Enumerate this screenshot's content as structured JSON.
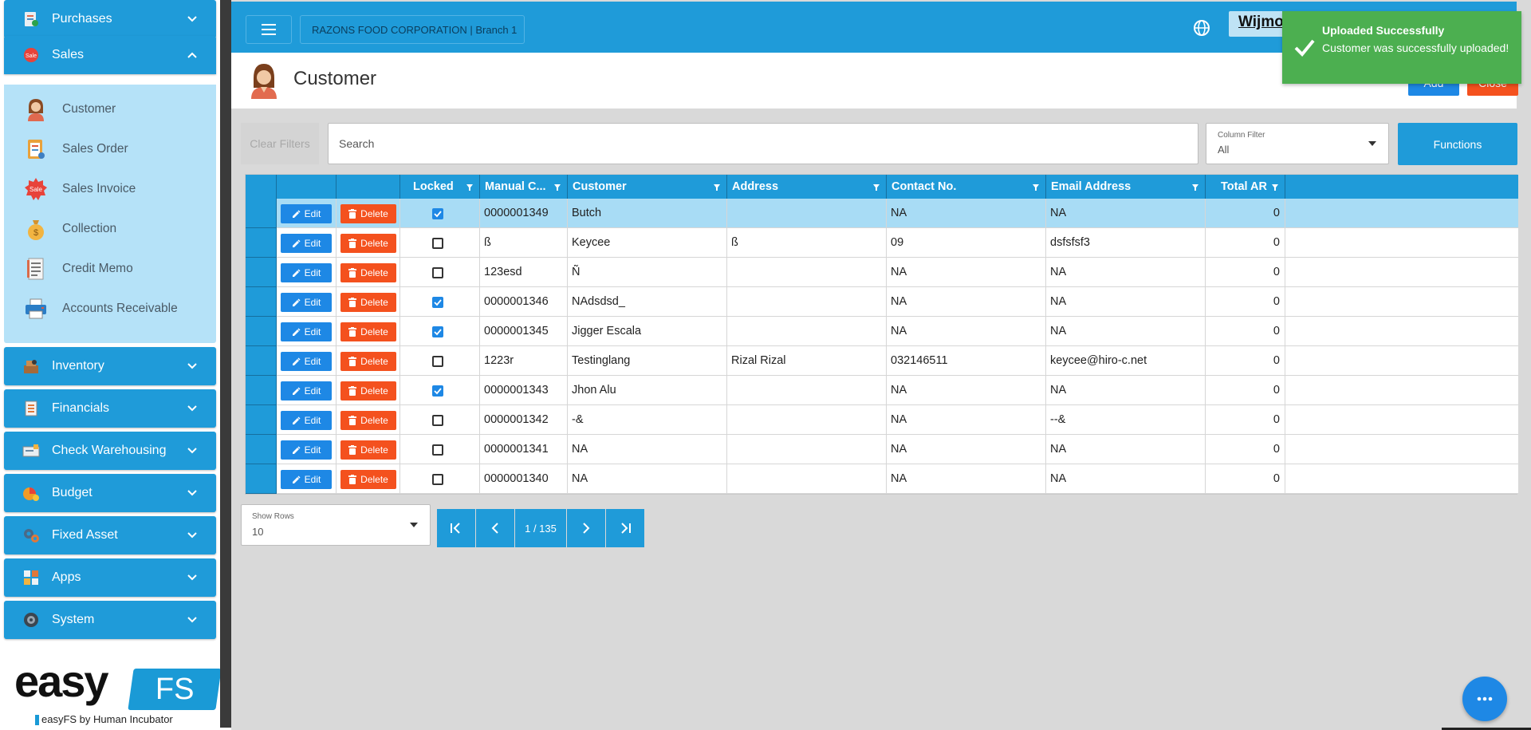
{
  "sidebar": {
    "groups_top": [
      {
        "label": "Purchases",
        "icon": "purchases-icon"
      },
      {
        "label": "Sales",
        "icon": "sale-tag-icon"
      }
    ],
    "sales_items": [
      {
        "label": "Customer",
        "icon": "customer-avatar-icon"
      },
      {
        "label": "Sales Order",
        "icon": "sales-order-icon"
      },
      {
        "label": "Sales Invoice",
        "icon": "sale-badge-icon"
      },
      {
        "label": "Collection",
        "icon": "money-bag-icon"
      },
      {
        "label": "Credit Memo",
        "icon": "memo-icon"
      },
      {
        "label": "Accounts Receivable",
        "icon": "printer-icon"
      }
    ],
    "groups_bottom": [
      {
        "label": "Inventory",
        "icon": "inventory-icon"
      },
      {
        "label": "Financials",
        "icon": "financials-icon"
      },
      {
        "label": "Check Warehousing",
        "icon": "check-icon"
      },
      {
        "label": "Budget",
        "icon": "budget-icon"
      },
      {
        "label": "Fixed Asset",
        "icon": "fixed-asset-icon"
      },
      {
        "label": "Apps",
        "icon": "apps-icon"
      },
      {
        "label": "System",
        "icon": "system-gear-icon"
      }
    ],
    "brand": {
      "easy": "easy",
      "fs": "FS",
      "tagline": "easyFS by Human Incubator"
    }
  },
  "topbar": {
    "company": "RAZONS FOOD CORPORATION | Branch 1",
    "user": "Wijmo"
  },
  "page": {
    "title": "Customer",
    "add_label": "Add",
    "close_label": "Close"
  },
  "toast": {
    "title": "Uploaded Successfully",
    "message": "Customer was successfully uploaded!"
  },
  "filters": {
    "clear_label": "Clear Filters",
    "search_placeholder": "Search",
    "column_filter_label": "Column Filter",
    "column_filter_value": "All",
    "functions_label": "Functions"
  },
  "grid": {
    "edit_label": "Edit",
    "delete_label": "Delete",
    "columns": [
      "Locked",
      "Manual C...",
      "Customer",
      "Address",
      "Contact No.",
      "Email Address",
      "Total AR"
    ],
    "rows": [
      {
        "locked": true,
        "manual_code": "0000001349",
        "customer": "Butch",
        "address": "",
        "contact": "NA",
        "email": "NA",
        "total_ar": "0",
        "selected": true
      },
      {
        "locked": false,
        "manual_code": "ß",
        "customer": "Keycee",
        "address": "ß",
        "contact": "09",
        "email": "dsfsfsf3",
        "total_ar": "0"
      },
      {
        "locked": false,
        "manual_code": "123esd",
        "customer": "Ñ",
        "address": "",
        "contact": "NA",
        "email": "NA",
        "total_ar": "0"
      },
      {
        "locked": true,
        "manual_code": "0000001346",
        "customer": "NAdsdsd_",
        "address": "",
        "contact": "NA",
        "email": "NA",
        "total_ar": "0"
      },
      {
        "locked": true,
        "manual_code": "0000001345",
        "customer": "Jigger Escala",
        "address": "",
        "contact": "NA",
        "email": "NA",
        "total_ar": "0"
      },
      {
        "locked": false,
        "manual_code": "1223r",
        "customer": "Testinglang",
        "address": "Rizal Rizal",
        "contact": "032146511",
        "email": "keycee@hiro-c.net",
        "total_ar": "0"
      },
      {
        "locked": true,
        "manual_code": "0000001343",
        "customer": "Jhon Alu",
        "address": "",
        "contact": "NA",
        "email": "NA",
        "total_ar": "0"
      },
      {
        "locked": false,
        "manual_code": "0000001342",
        "customer": "-&",
        "address": "",
        "contact": "NA",
        "email": "--&",
        "total_ar": "0"
      },
      {
        "locked": false,
        "manual_code": "0000001341",
        "customer": "NA",
        "address": "",
        "contact": "NA",
        "email": "NA",
        "total_ar": "0"
      },
      {
        "locked": false,
        "manual_code": "0000001340",
        "customer": "NA",
        "address": "",
        "contact": "NA",
        "email": "NA",
        "total_ar": "0"
      }
    ]
  },
  "pager": {
    "show_rows_label": "Show Rows",
    "show_rows_value": "10",
    "page_indicator": "1 / 135"
  },
  "colors": {
    "primary": "#1f9bd9",
    "sidebar_panel": "#b5e2f8",
    "edit": "#1e88e5",
    "delete": "#f4511e",
    "toast_success": "#4caf50",
    "selected_row": "#a8dcf5"
  }
}
